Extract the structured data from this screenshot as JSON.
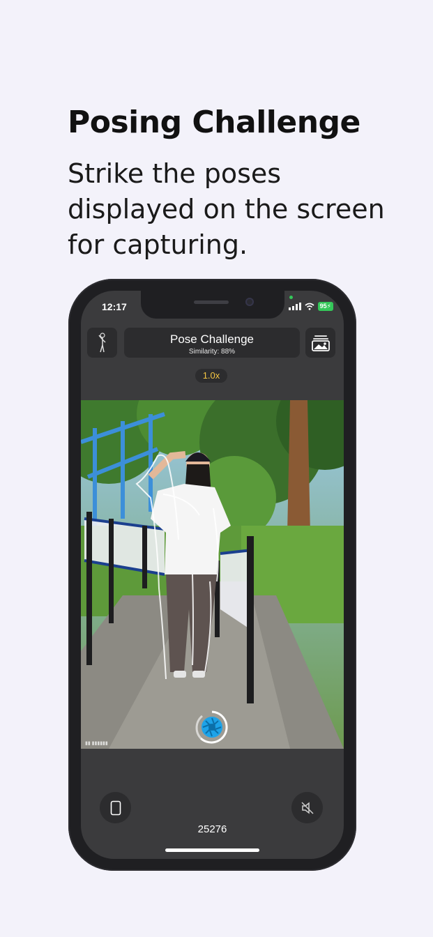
{
  "marketing": {
    "title": "Posing Challenge",
    "subtitle": "Strike the poses displayed on the screen for capturing."
  },
  "status_bar": {
    "time": "12:17",
    "battery": "95"
  },
  "header": {
    "title": "Pose Challenge",
    "similarity": "Similarity: 88%"
  },
  "zoom": "1.0x",
  "footer": {
    "counter": "25276"
  },
  "icons": {
    "left_top": "pose-figure-icon",
    "right_top": "gallery-icon",
    "left_bottom": "phone-outline-icon",
    "right_bottom": "mute-icon"
  },
  "colors": {
    "background": "#f3f2fa",
    "accent": "#f4c542",
    "shutter": "#1ea3e8"
  }
}
